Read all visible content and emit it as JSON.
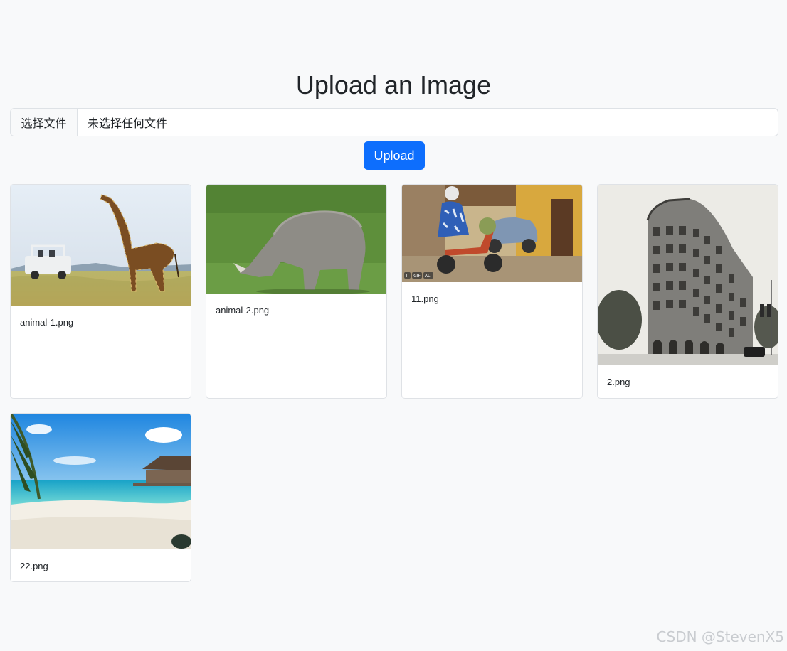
{
  "page": {
    "title": "Upload an Image"
  },
  "file_input": {
    "button_label": "选择文件",
    "status_text": "未选择任何文件"
  },
  "upload_button": {
    "label": "Upload",
    "color": "#0d6efd"
  },
  "gallery": {
    "cards": [
      {
        "filename": "animal-1.png",
        "image": "giraffe-photo"
      },
      {
        "filename": "animal-2.png",
        "image": "rhino-photo"
      },
      {
        "filename": "11.png",
        "image": "woman-on-scooter-photo",
        "badges": [
          "II",
          "GIF",
          "ALT"
        ]
      },
      {
        "filename": "2.png",
        "image": "flatiron-building-photo"
      },
      {
        "filename": "22.png",
        "image": "beach-photo"
      }
    ]
  },
  "watermark": "CSDN @StevenX5"
}
